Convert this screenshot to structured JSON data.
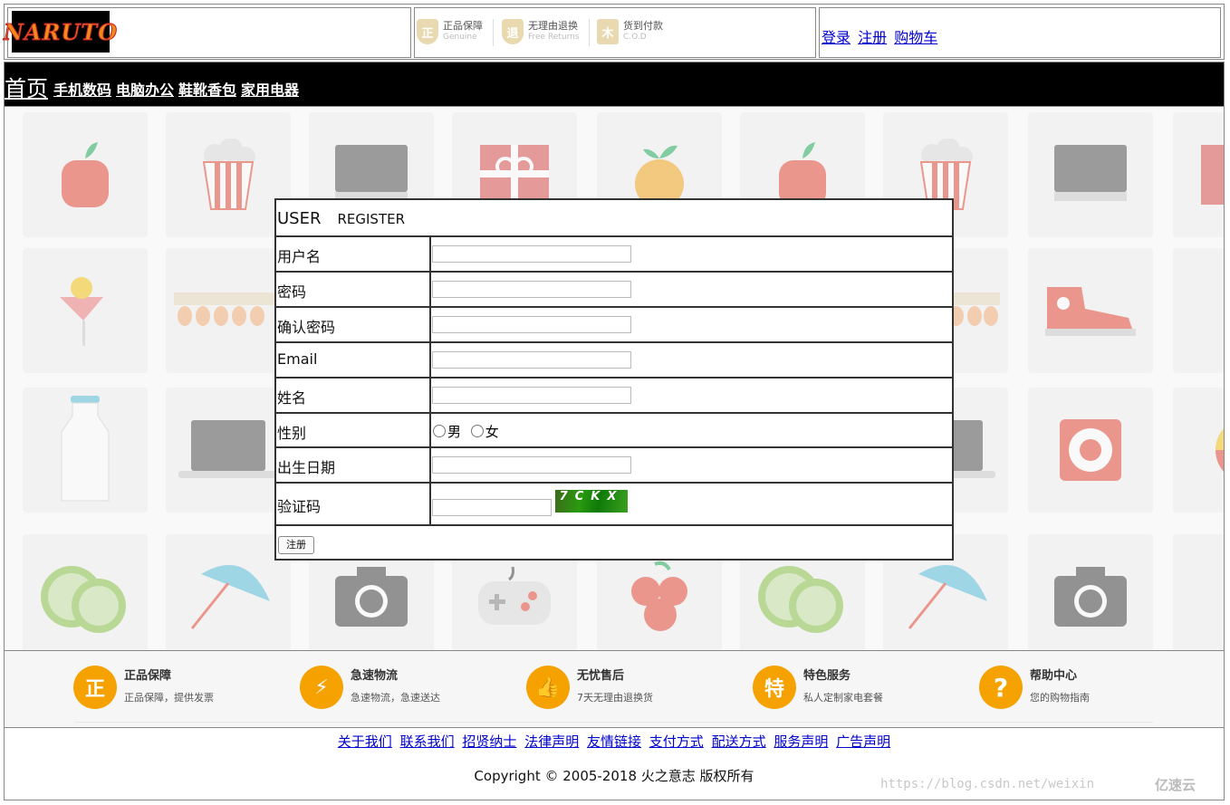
{
  "header": {
    "logo_text": "NARUTO",
    "guarantees": [
      {
        "title": "正品保障",
        "sub": "Genuine",
        "icon": "genuine-shield-icon",
        "glyph": "正"
      },
      {
        "title": "无理由退换",
        "sub": "Free Returns",
        "icon": "returns-shield-icon",
        "glyph": "退"
      },
      {
        "title": "货到付款",
        "sub": "C.O.D",
        "icon": "cod-icon",
        "glyph": "木"
      }
    ],
    "links": {
      "login": "登录",
      "register": "注册",
      "cart": "购物车"
    }
  },
  "nav": {
    "home": "首页",
    "items": [
      "手机数码",
      "电脑办公",
      "鞋靴香包",
      "家用电器"
    ]
  },
  "form": {
    "title": "USER",
    "subtitle": "REGISTER",
    "fields": {
      "username": "用户名",
      "password": "密码",
      "confirm": "确认密码",
      "email": "Email",
      "name": "姓名",
      "gender": "性别",
      "birthday": "出生日期",
      "captcha": "验证码"
    },
    "gender_options": {
      "male": "男",
      "female": "女"
    },
    "captcha_text": "7CKX",
    "submit": "注册"
  },
  "features": [
    {
      "title": "正品保障",
      "desc": "正品保障，提供发票",
      "icon": "genuine-icon",
      "glyph": "正"
    },
    {
      "title": "急速物流",
      "desc": "急速物流，急速送达",
      "icon": "logistics-icon",
      "glyph": "⚡"
    },
    {
      "title": "无忧售后",
      "desc": "7天无理由退换货",
      "icon": "thumbs-up-icon",
      "glyph": "👍"
    },
    {
      "title": "特色服务",
      "desc": "私人定制家电套餐",
      "icon": "special-service-icon",
      "glyph": "特"
    },
    {
      "title": "帮助中心",
      "desc": "您的购物指南",
      "icon": "help-icon",
      "glyph": "?"
    }
  ],
  "footer": {
    "links": [
      "关于我们",
      "联系我们",
      "招贤纳士",
      "法律声明",
      "友情链接",
      "支付方式",
      "配送方式",
      "服务声明",
      "广告声明"
    ],
    "copyright": "Copyright © 2005-2018 火之意志 版权所有"
  },
  "watermark": {
    "url": "https://blog.csdn.net/weixin",
    "brand": "亿速云"
  }
}
